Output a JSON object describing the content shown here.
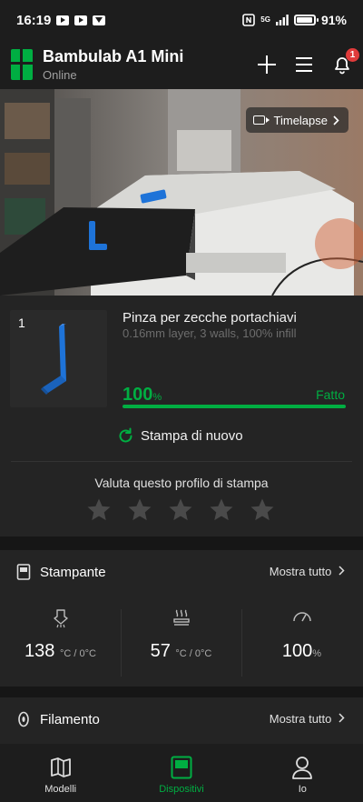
{
  "status_bar": {
    "time": "16:19",
    "network": "5G",
    "battery": "91%"
  },
  "header": {
    "title": "Bambulab A1 Mini",
    "subtitle": "Online",
    "notification_count": "1"
  },
  "camera": {
    "timelapse_label": "Timelapse"
  },
  "job": {
    "thumbnail_index": "1",
    "name": "Pinza per zecche portachiavi",
    "params": "0.16mm layer, 3 walls, 100% infill",
    "progress_value": "100",
    "progress_unit": "%",
    "progress_fraction": 1.0,
    "status": "Fatto",
    "reprint_label": "Stampa di nuovo",
    "rating_title": "Valuta questo profilo di stampa",
    "rating": 0,
    "rating_max": 5
  },
  "printer": {
    "title": "Stampante",
    "show_all": "Mostra tutto",
    "stats": [
      {
        "value": "138",
        "unit": "°C / 0°C",
        "icon": "nozzle-temperature-icon"
      },
      {
        "value": "57",
        "unit": "°C / 0°C",
        "icon": "bed-temperature-icon"
      },
      {
        "value": "100",
        "unit": "%",
        "icon": "speed-gauge-icon"
      }
    ]
  },
  "filament": {
    "title": "Filamento",
    "show_all": "Mostra tutto"
  },
  "nav": {
    "items": [
      {
        "label": "Modelli",
        "icon": "models-icon"
      },
      {
        "label": "Dispositivi",
        "icon": "devices-icon",
        "active": true
      },
      {
        "label": "Io",
        "icon": "profile-icon"
      }
    ]
  },
  "colors": {
    "accent": "#00ae42",
    "background": "#1d1d1d",
    "card": "#242424",
    "badge": "#e03b3b",
    "model_blue": "#1e73d8"
  }
}
